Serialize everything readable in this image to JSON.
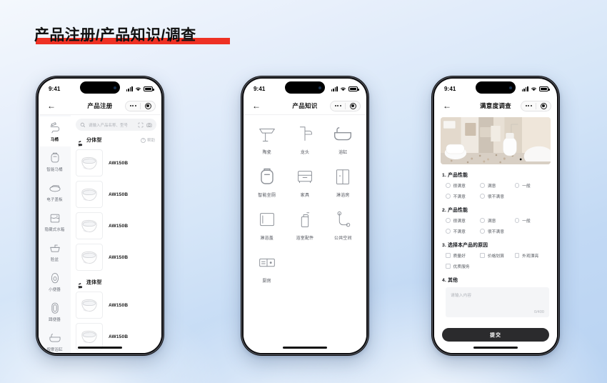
{
  "page": {
    "title": "产品注册/产品知识/调查",
    "accent_red": "#ee3124",
    "background_gradient_from": "#f4f8fd",
    "background_gradient_to": "#b9d3f2"
  },
  "status_bar": {
    "time": "9:41"
  },
  "phone1": {
    "nav": {
      "back": "←",
      "title": "产品注册"
    },
    "search": {
      "placeholder": "请输入产品名称、型号"
    },
    "help_label": "帮助",
    "categories": [
      {
        "name": "分体型",
        "products": [
          {
            "model": "AW150B"
          },
          {
            "model": "AW150B"
          },
          {
            "model": "AW150B"
          },
          {
            "model": "AW150B"
          }
        ]
      },
      {
        "name": "连体型",
        "products": [
          {
            "model": "AW150B"
          },
          {
            "model": "AW150B"
          }
        ]
      }
    ],
    "sidebar": [
      {
        "label": "马桶",
        "icon": "toilet-icon",
        "active": true
      },
      {
        "label": "智能马桶",
        "icon": "smart-toilet-icon",
        "active": false
      },
      {
        "label": "电子盖板",
        "icon": "toilet-seat-icon",
        "active": false
      },
      {
        "label": "隐藏式水箱",
        "icon": "concealed-cistern-icon",
        "active": false
      },
      {
        "label": "脸盆",
        "icon": "basin-icon",
        "active": false
      },
      {
        "label": "小便器",
        "icon": "urinal-icon",
        "active": false
      },
      {
        "label": "蹲便器",
        "icon": "squat-toilet-icon",
        "active": false
      },
      {
        "label": "按摩浴缸",
        "icon": "bathtub-icon",
        "active": false
      }
    ]
  },
  "phone2": {
    "nav": {
      "back": "←",
      "title": "产品知识"
    },
    "grid": [
      {
        "label": "陶瓷",
        "icon": "ceramic-basin-icon"
      },
      {
        "label": "龙头",
        "icon": "faucet-icon"
      },
      {
        "label": "浴缸",
        "icon": "bathtub-icon"
      },
      {
        "label": "智能坐厕",
        "icon": "smart-toilet-icon"
      },
      {
        "label": "家具",
        "icon": "furniture-cabinet-icon"
      },
      {
        "label": "淋浴房",
        "icon": "shower-room-icon"
      },
      {
        "label": "淋浴盖",
        "icon": "shower-tray-icon"
      },
      {
        "label": "浴室配件",
        "icon": "bathroom-accessory-icon"
      },
      {
        "label": "公共空间",
        "icon": "public-space-icon"
      },
      {
        "label": "厨房",
        "icon": "kitchen-icon"
      }
    ]
  },
  "phone3": {
    "nav": {
      "back": "←",
      "title": "满意度调查"
    },
    "hero_alt": "bathroom-photo",
    "questions": [
      {
        "number": "1.",
        "title": "产品性能",
        "type": "radio",
        "options": [
          "很满意",
          "满意",
          "一般",
          "不满意",
          "很不满意"
        ]
      },
      {
        "number": "2.",
        "title": "产品性能",
        "type": "radio",
        "options": [
          "很满意",
          "满意",
          "一般",
          "不满意",
          "很不满意"
        ]
      },
      {
        "number": "3.",
        "title": "选择本产品的原因",
        "type": "checkbox",
        "options": [
          "质量好",
          "价格划算",
          "外观漂亮",
          "优质服务"
        ]
      },
      {
        "number": "4.",
        "title": "其他",
        "type": "textarea"
      }
    ],
    "textarea": {
      "placeholder": "请输入内容",
      "counter": "0/400",
      "value": ""
    },
    "submit_label": "提交"
  }
}
